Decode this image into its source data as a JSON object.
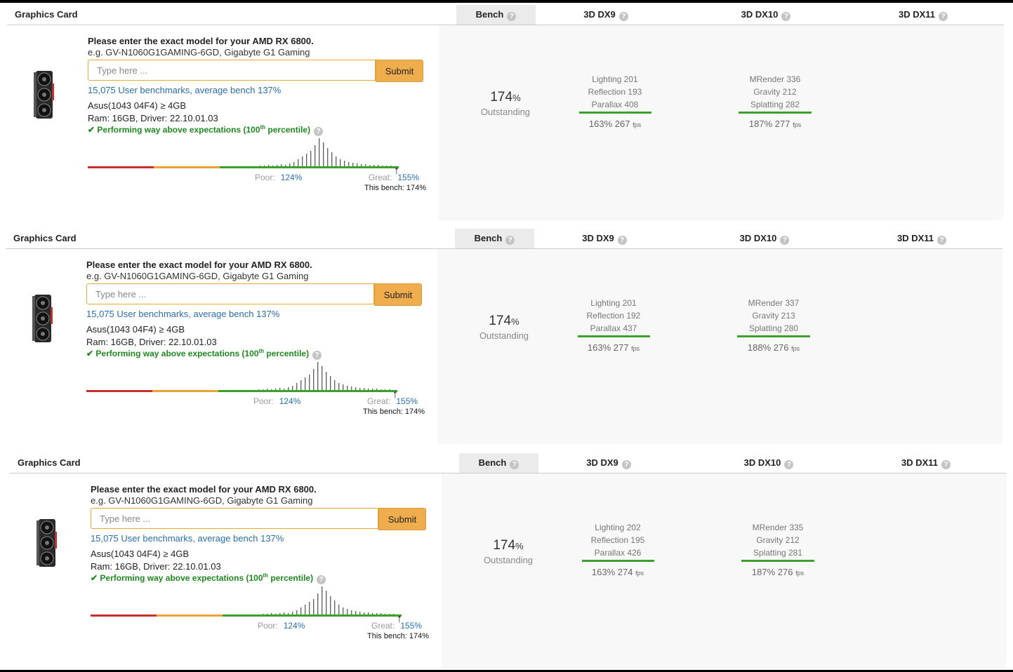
{
  "colors": {
    "accent_orange": "#f0ad4e",
    "link_blue": "#2a6eb0",
    "success_green": "#1f8a1f",
    "bar_red": "#c9302c",
    "bar_orange": "#eea236",
    "bar_green": "#3ca02c"
  },
  "columns": {
    "card": "Graphics Card",
    "bench": "Bench",
    "dx9": "3D DX9",
    "dx10": "3D DX10",
    "dx11": "3D DX11",
    "help": "?"
  },
  "common": {
    "prompt": "Please enter the exact model for your AMD RX 6800.",
    "example": "e.g. GV-N1060G1GAMING-6GD, Gigabyte G1 Gaming",
    "placeholder": "Type here ...",
    "submit": "Submit",
    "user_benchmarks": "15,075 User benchmarks, average bench 137%",
    "checkmark": "✔",
    "perf_pre": "Performing way above expectations (100",
    "perf_sup": "th",
    "perf_post": " percentile)",
    "poor_label": "Poor:",
    "poor_value": "124%",
    "great_label": "Great:",
    "great_value": "155%",
    "arrow": "↑",
    "rating": "Outstanding",
    "pct_unit": "%",
    "fps_unit": "fps",
    "icon": "graphics-card-icon"
  },
  "entries": [
    {
      "line1": "Asus(1043 04F4) ≥ 4GB",
      "line2": "Ram: 16GB, Driver: 22.10.01.03",
      "this_bench": "This bench: 174%",
      "bench_value": "174",
      "dx9": {
        "l1": "Lighting 201",
        "l2": "Reflection 193",
        "l3": "Parallax 408",
        "summary": "163% 267"
      },
      "dx10": {
        "l1": "MRender 336",
        "l2": "Gravity 212",
        "l3": "Splatting 282",
        "summary": "187% 277"
      }
    },
    {
      "line1": "Asus(1043 04F4) ≥ 4GB",
      "line2": "Ram: 16GB, Driver: 22.10.01.03",
      "this_bench": "This bench: 174%",
      "bench_value": "174",
      "dx9": {
        "l1": "Lighting 201",
        "l2": "Reflection 192",
        "l3": "Parallax 437",
        "summary": "163% 277"
      },
      "dx10": {
        "l1": "MRender 337",
        "l2": "Gravity 213",
        "l3": "Splatting 280",
        "summary": "188% 276"
      }
    },
    {
      "line1": "Asus(1043 04F4) ≥ 4GB",
      "line2": "Ram: 16GB, Driver: 22.10.01.03",
      "this_bench": "This bench: 174%",
      "bench_value": "174",
      "dx9": {
        "l1": "Lighting 202",
        "l2": "Reflection 195",
        "l3": "Parallax 426",
        "summary": "163% 274"
      },
      "dx10": {
        "l1": "MRender 335",
        "l2": "Gravity 212",
        "l3": "Splatting 281",
        "summary": "187% 276"
      }
    }
  ]
}
